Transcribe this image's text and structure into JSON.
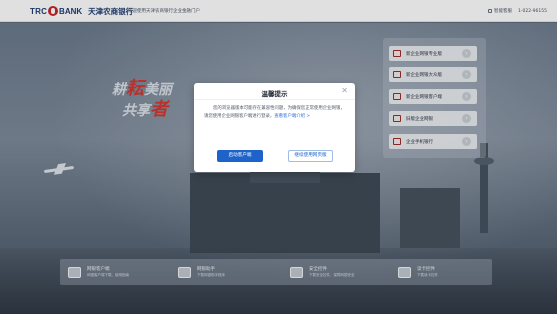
{
  "header": {
    "logo_trc": "TRC",
    "logo_bank": "BANK",
    "bank_name": "天津农商银行",
    "welcome": "欢迎使用天津农商银行企业金融门户",
    "assist_link": "智能客服",
    "phone": "1-022-96155"
  },
  "slogan": {
    "line1_prefix": "耕",
    "line1_red": "耘",
    "line1_suffix": "美丽",
    "line2_prefix": "共享",
    "line2_red": "者"
  },
  "side_menu": {
    "items": [
      {
        "label": "新企业网银专业版",
        "icon": "bank-card-icon"
      },
      {
        "label": "新企业网银大众版",
        "icon": "bank-card-icon"
      },
      {
        "label": "新企业网银客户端",
        "icon": "bank-card-icon"
      },
      {
        "label": "旧版企业网银",
        "icon": "bank-card-icon"
      },
      {
        "label": "企业手机银行",
        "icon": "phone-icon"
      }
    ]
  },
  "bottom_bar": {
    "items": [
      {
        "title": "网银客户端",
        "subtitle": "网银客户端下载、使用指南",
        "icon": "monitor-icon"
      },
      {
        "title": "网银助手",
        "subtitle": "下载网银助手程序",
        "icon": "tools-icon"
      },
      {
        "title": "安全控件",
        "subtitle": "下载安全控件，保障网银安全",
        "icon": "shield-icon"
      },
      {
        "title": "读卡控件",
        "subtitle": "下载读卡控件",
        "icon": "usb-key-icon"
      }
    ]
  },
  "dialog": {
    "title": "温馨提示",
    "body": "您的浏览器版本可能存在兼容性问题，为确保您正常使用企业网银，请您使用企业网银客户端进行登录，",
    "link": "查看客户端介绍 >",
    "primary_button": "启动客户端",
    "secondary_button": "继续使用网页版",
    "close_symbol": "✕"
  },
  "colors": {
    "brand_blue": "#1e63c9",
    "logo_red": "#c6262c",
    "link_blue": "#2a6fd4"
  }
}
